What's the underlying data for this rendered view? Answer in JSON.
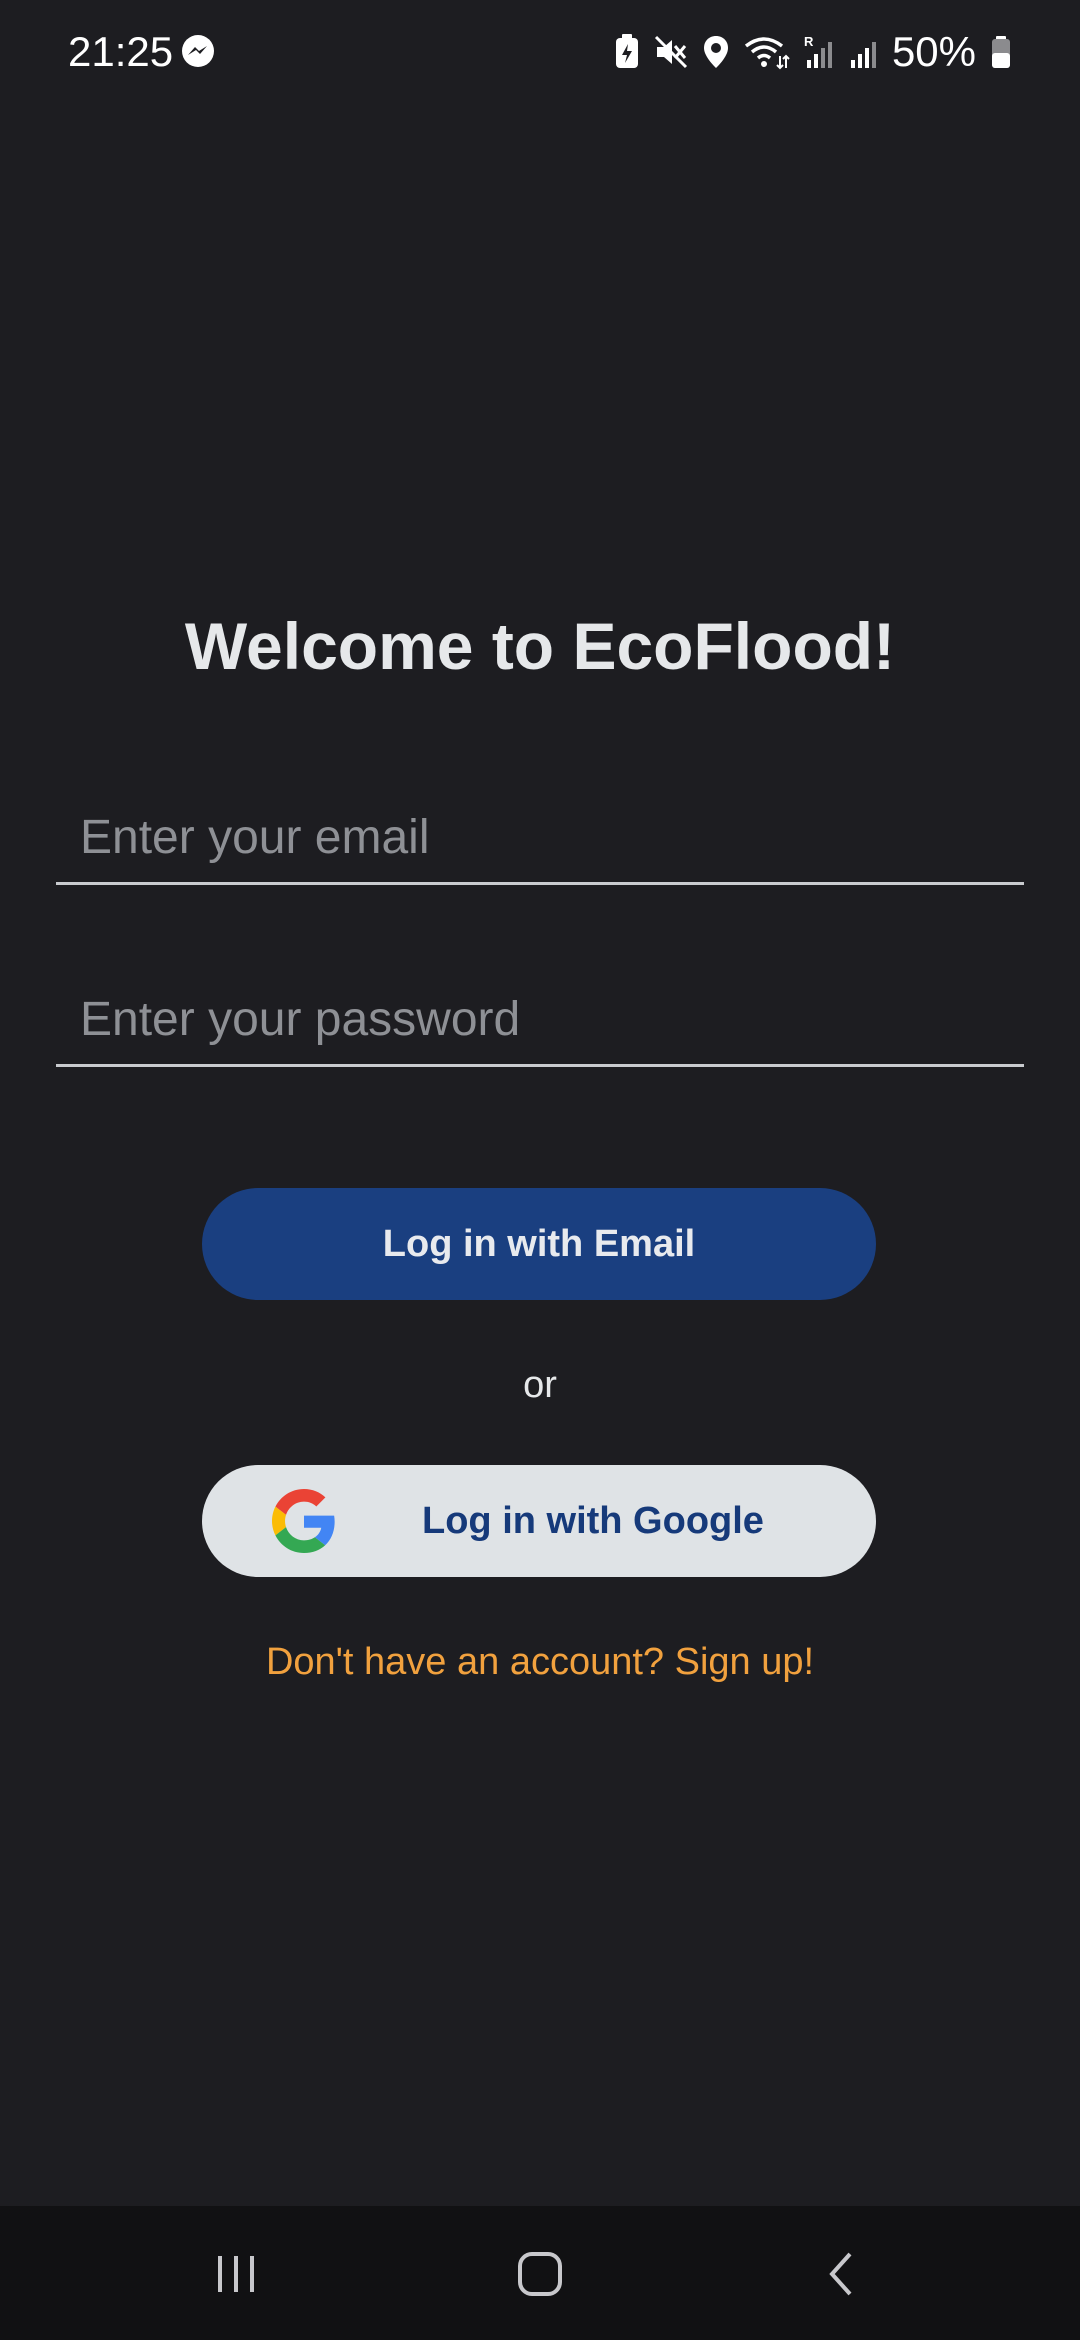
{
  "status_bar": {
    "time": "21:25",
    "battery_percent": "50%",
    "icons": [
      "messenger-icon",
      "battery-saver-icon",
      "mute-icon",
      "location-icon",
      "wifi-icon",
      "signal-roaming-icon",
      "signal-icon",
      "battery-icon"
    ]
  },
  "login": {
    "title": "Welcome to EcoFlood!",
    "email_placeholder": "Enter your email",
    "email_value": "",
    "password_placeholder": "Enter your password",
    "password_value": "",
    "email_button_label": "Log in with Email",
    "or_label": "or",
    "google_button_label": "Log in with Google",
    "signup_link": "Don't have an account? Sign up!"
  },
  "nav_bar": {
    "buttons": [
      "recents-icon",
      "home-icon",
      "back-icon"
    ]
  },
  "colors": {
    "background": "#1d1d21",
    "primary_button": "#1a3f80",
    "google_button": "#dfe3e6",
    "link": "#f1a13e",
    "nav_bar": "#111113"
  }
}
